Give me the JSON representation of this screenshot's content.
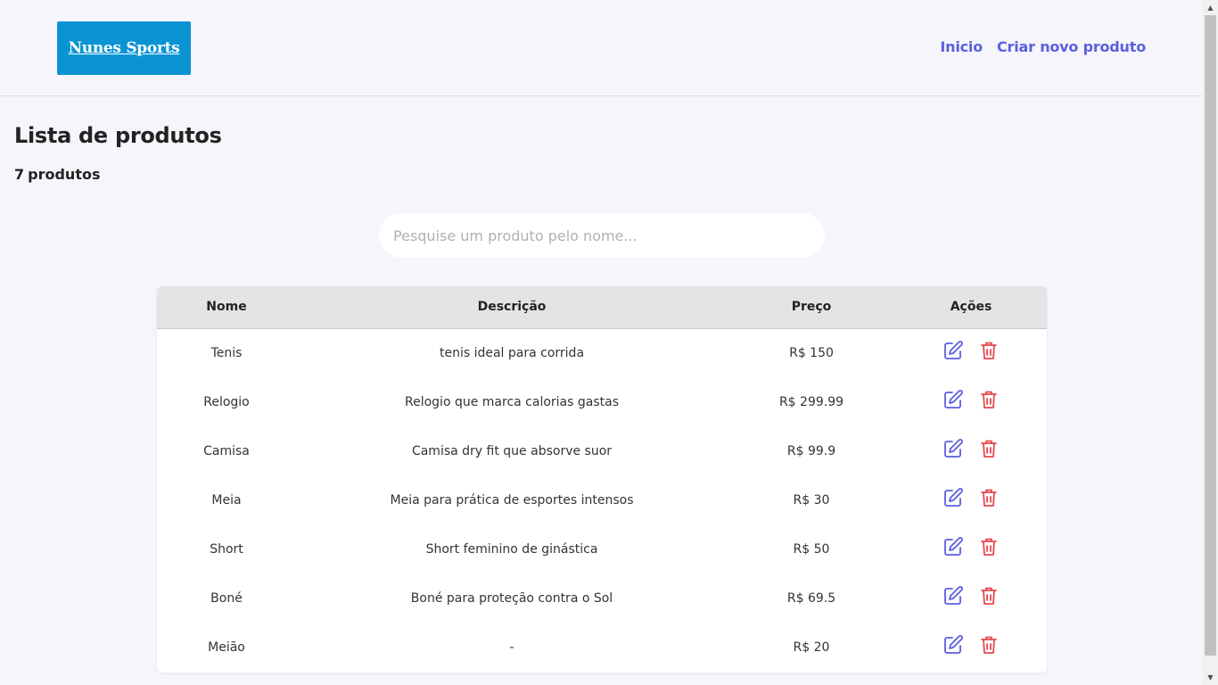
{
  "header": {
    "logo_text": "Nunes Sports",
    "nav": [
      {
        "label": "Inicio"
      },
      {
        "label": "Criar novo produto"
      }
    ]
  },
  "main": {
    "title": "Lista de produtos",
    "count_value": "7",
    "count_label": "produtos",
    "search": {
      "placeholder": "Pesquise um produto pelo nome...",
      "value": ""
    }
  },
  "table": {
    "headers": {
      "name": "Nome",
      "description": "Descrição",
      "price": "Preço",
      "actions": "Ações"
    },
    "rows": [
      {
        "name": "Tenis",
        "description": "tenis ideal para corrida",
        "price": "R$ 150"
      },
      {
        "name": "Relogio",
        "description": "Relogio que marca calorias gastas",
        "price": "R$ 299.99"
      },
      {
        "name": "Camisa",
        "description": "Camisa dry fit que absorve suor",
        "price": "R$ 99.9"
      },
      {
        "name": "Meia",
        "description": "Meia para prática de esportes intensos",
        "price": "R$ 30"
      },
      {
        "name": "Short",
        "description": "Short feminino de ginástica",
        "price": "R$ 50"
      },
      {
        "name": "Boné",
        "description": "Boné para proteção contra o Sol",
        "price": "R$ 69.5"
      },
      {
        "name": "Meião",
        "description": "-",
        "price": "R$ 20"
      }
    ],
    "action_icons": {
      "edit": "edit-icon",
      "delete": "trash-icon"
    }
  },
  "colors": {
    "accent": "#5b5fe0",
    "logo_bg": "#0a94d3",
    "delete": "#e5484d",
    "background": "#f5f5fb",
    "table_header": "#e4e4e6"
  }
}
